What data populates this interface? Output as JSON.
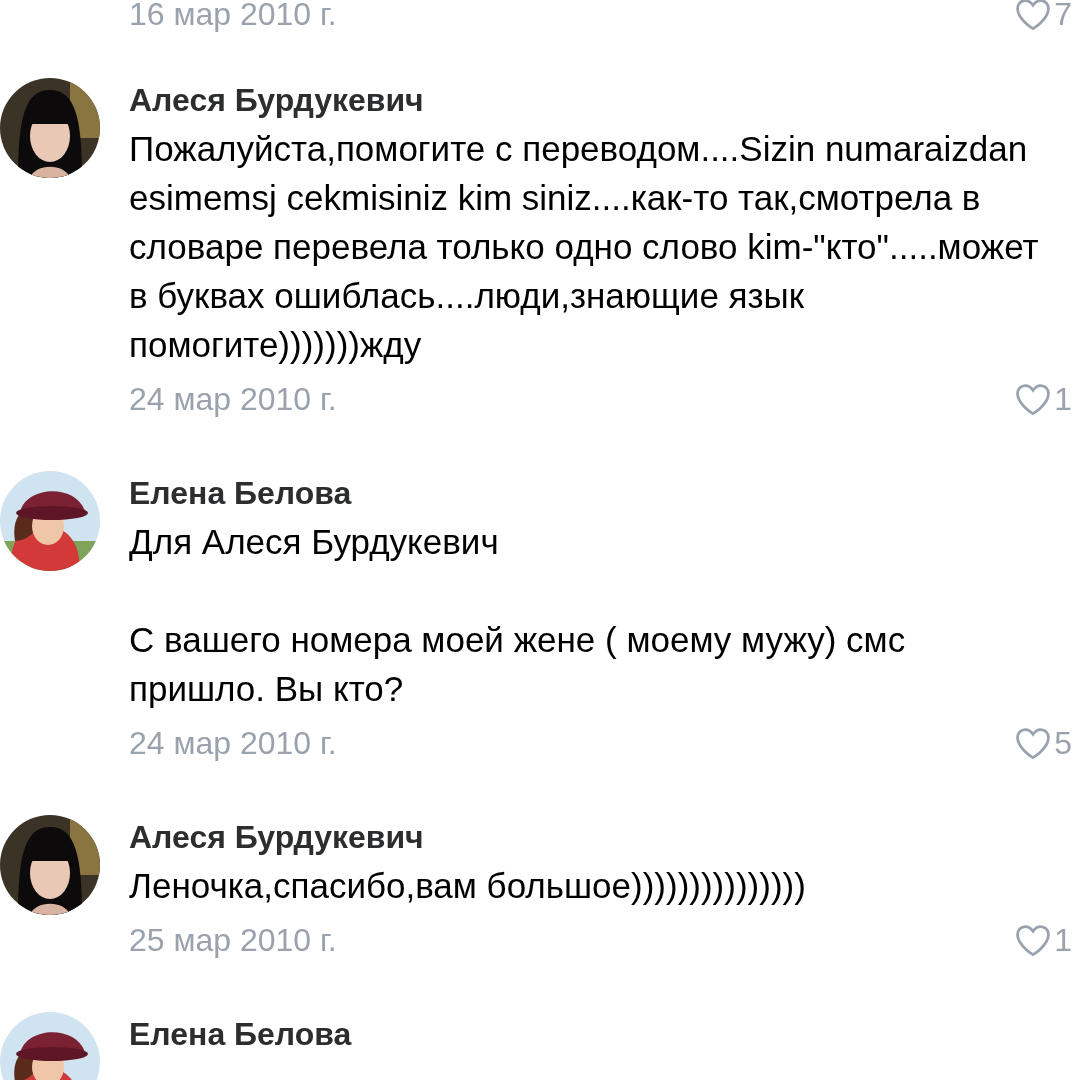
{
  "top_comment": {
    "date": "16 мар 2010 г.",
    "likes": "7"
  },
  "comments": [
    {
      "author": "Алеся Бурдукевич",
      "text": "Пожалуйста,помогите с переводом....Sizin numaraizdan esimemsj cekmisiniz kim siniz....как-то так,смотрела в словаре перевела только одно слово kim-\"кто\".....может в буквах ошиблась....люди,знающие язык помогите)))))))жду",
      "date": "24 мар 2010 г.",
      "likes": "1"
    },
    {
      "author": "Елена Белова",
      "text": "Для Алеся Бурдукевич\n\nС вашего номера моей жене ( моему мужу) смс пришло. Вы кто?",
      "date": "24 мар 2010 г.",
      "likes": "5"
    },
    {
      "author": "Алеся Бурдукевич",
      "text": "Леночка,спасибо,вам большое)))))))))))))))",
      "date": "25 мар 2010 г.",
      "likes": "1"
    },
    {
      "author": "Елена Белова"
    }
  ]
}
